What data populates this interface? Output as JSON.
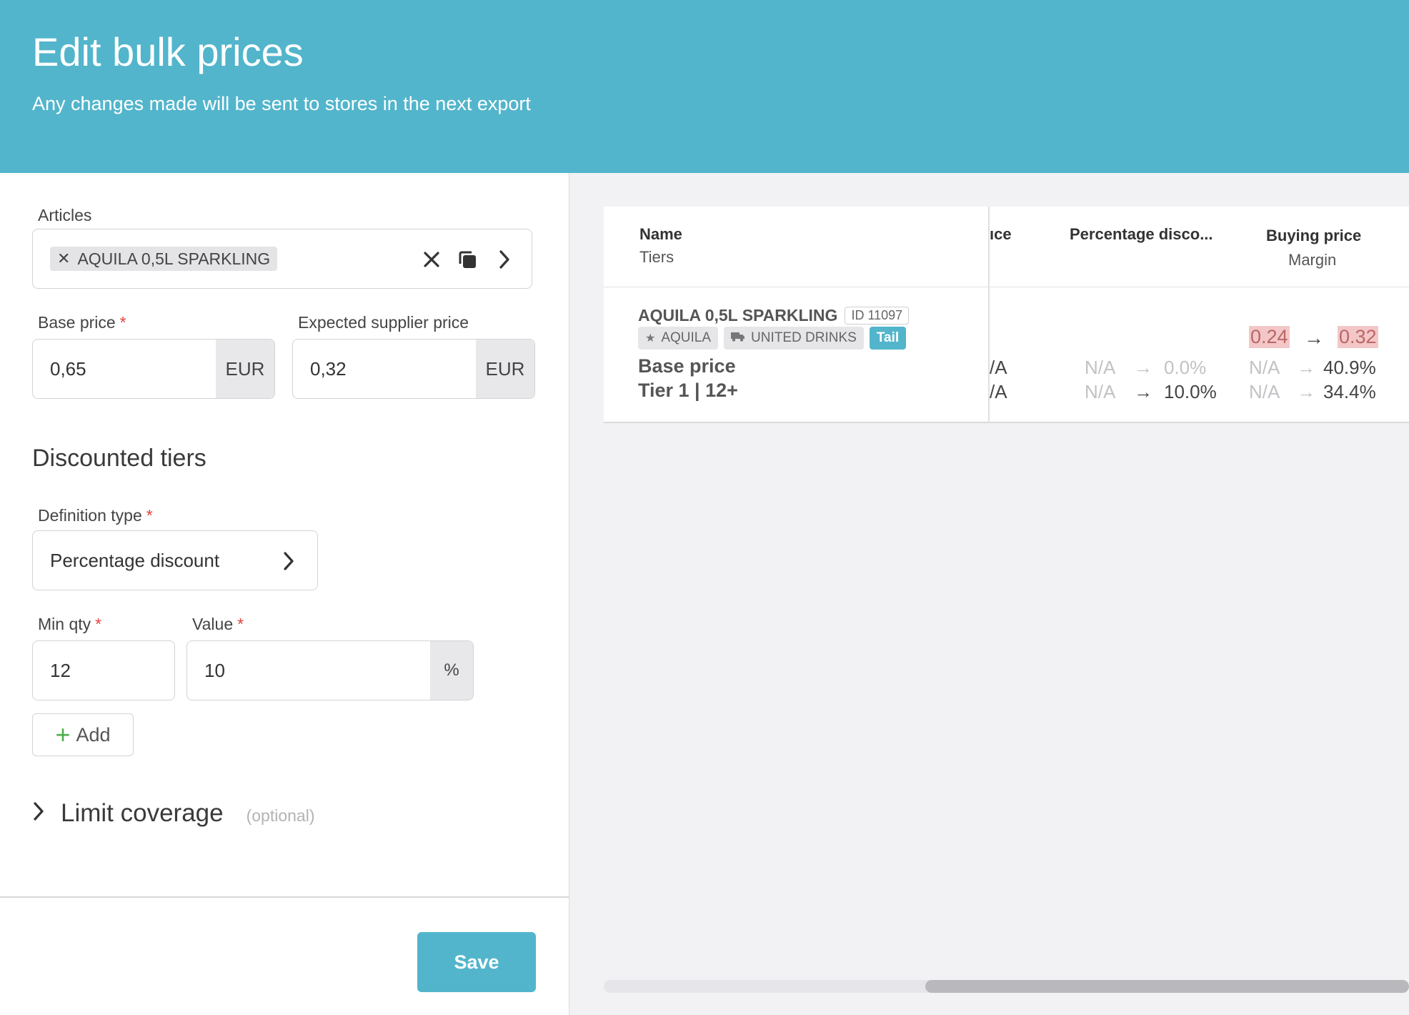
{
  "header": {
    "title": "Edit bulk prices",
    "subtitle": "Any changes made will be sent to stores in the next export"
  },
  "form": {
    "articles": {
      "label": "Articles",
      "chip": "AQUILA 0,5L SPARKLING"
    },
    "base_price": {
      "label": "Base price",
      "value": "0,65",
      "currency": "EUR"
    },
    "expected_supplier_price": {
      "label": "Expected supplier price",
      "value": "0,32",
      "currency": "EUR"
    },
    "discounted_tiers": {
      "title": "Discounted tiers",
      "definition_type": {
        "label": "Definition type",
        "value": "Percentage discount"
      },
      "min_qty": {
        "label": "Min qty",
        "value": "12"
      },
      "value": {
        "label": "Value",
        "value": "10",
        "unit": "%"
      },
      "add_label": "Add"
    },
    "limit_coverage": {
      "label": "Limit coverage",
      "optional": "(optional)"
    },
    "save_label": "Save",
    "required_mark": "*"
  },
  "table": {
    "columns": {
      "name": {
        "title": "Name",
        "sub": "Tiers"
      },
      "price_partial": "ıce",
      "percentage_discount": "Percentage disco...",
      "buying_price": {
        "title": "Buying price",
        "sub": "Margin"
      }
    },
    "article": {
      "name": "AQUILA 0,5L SPARKLING",
      "id": "ID 11097",
      "tags": [
        "AQUILA",
        "UNITED DRINKS",
        "Tail"
      ]
    },
    "buying_price_change": {
      "from": "0.24",
      "arrow": "→",
      "to": "0.32"
    },
    "rows": [
      {
        "label": "Base price",
        "price_partial": "/A",
        "discount_from": "N/A",
        "discount_arrow": "→",
        "discount_to": "0.0%",
        "margin_from": "N/A",
        "margin_arrow": "→",
        "margin_to": "40.9%"
      },
      {
        "label": "Tier 1 | 12+",
        "price_partial": "/A",
        "discount_from": "N/A",
        "discount_arrow": "→",
        "discount_to": "10.0%",
        "margin_from": "N/A",
        "margin_arrow": "→",
        "margin_to": "34.4%"
      }
    ]
  },
  "colors": {
    "accent": "#52b5cb",
    "highlight": "#f3c7c7",
    "required": "#e0443c",
    "add_plus": "#4cae4c"
  },
  "icons": {
    "chip_remove": "close-icon",
    "clear": "close-icon",
    "copy": "copy-icon",
    "expand": "chevron-right-icon",
    "brand_tag": "star-icon",
    "supplier_tag": "truck-icon"
  }
}
